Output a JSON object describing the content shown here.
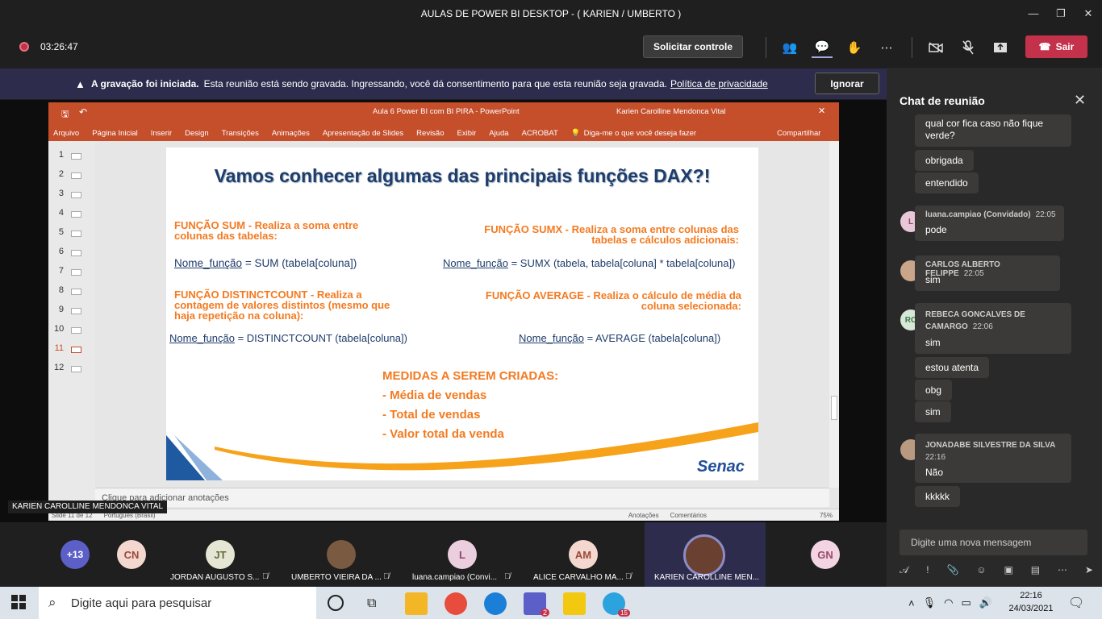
{
  "window": {
    "title": "AULAS DE POWER BI DESKTOP - ( KARIEN / UMBERTO )",
    "min": "—",
    "max": "❐",
    "close": "✕"
  },
  "toolbar": {
    "timer": "03:26:47",
    "request_control": "Solicitar controle",
    "leave_label": "Sair"
  },
  "banner": {
    "bold": "A gravação foi iniciada.",
    "text": "Esta reunião está sendo gravada. Ingressando, você dá consentimento para que esta reunião seja gravada.",
    "link": "Política de privacidade",
    "ignore": "Ignorar"
  },
  "ppt": {
    "doc_title": "Aula 6 Power BI com BI PIRA  -  PowerPoint",
    "user": "Karien Carolline Mendonca Vital",
    "ribbon": [
      "Arquivo",
      "Página Inicial",
      "Inserir",
      "Design",
      "Transições",
      "Animações",
      "Apresentação de Slides",
      "Revisão",
      "Exibir",
      "Ajuda",
      "ACROBAT"
    ],
    "tell_me": "Diga-me o que você deseja fazer",
    "share": "Compartilhar",
    "thumbs": [
      "1",
      "2",
      "3",
      "4",
      "5",
      "6",
      "7",
      "8",
      "9",
      "10",
      "11",
      "12"
    ],
    "notes": "Clique para adicionar anotações",
    "status_slide": "Slide 11 de 12",
    "status_lang": "Português (Brasil)",
    "status_notes": "Anotações",
    "status_comments": "Comentários",
    "zoom": "75%"
  },
  "slide": {
    "title": "Vamos conhecer algumas das principais funções DAX?!",
    "sum_head": "FUNÇÃO SUM - Realiza a soma entre colunas das tabelas:",
    "sum_formula_fn": "Nome_função",
    "sum_formula": " = SUM (tabela[coluna])",
    "sumx_head": "FUNÇÃO SUMX - Realiza a soma entre colunas das tabelas e cálculos adicionais:",
    "sumx_formula_fn": "Nome_função",
    "sumx_formula": " = SUMX (tabela, tabela[coluna] * tabela[coluna])",
    "dc_head": "FUNÇÃO DISTINCTCOUNT - Realiza a contagem de valores distintos (mesmo que haja repetição na coluna):",
    "dc_formula_fn": "Nome_função",
    "dc_formula": " = DISTINCTCOUNT (tabela[coluna])",
    "avg_head": "FUNÇÃO AVERAGE - Realiza o cálculo de média da coluna selecionada:",
    "avg_formula_fn": "Nome_função",
    "avg_formula": " = AVERAGE (tabela[coluna])",
    "medidas_head": "MEDIDAS A SEREM CRIADAS:",
    "medidas": [
      "-  Média de vendas",
      "-  Total de vendas",
      "-  Valor total da venda"
    ],
    "logo": "Senac"
  },
  "presenter_tag": "KARIEN CAROLLINE MENDONCA VITAL",
  "chat": {
    "title": "Chat de reunião",
    "messages": [
      {
        "text": "qual cor fica caso não fique verde?"
      },
      {
        "text": "obrigada"
      },
      {
        "text": "entendido"
      },
      {
        "author": "luana.campiao (Convidado)",
        "time": "22:05",
        "initials": "L",
        "text": "pode"
      },
      {
        "author": "CARLOS ALBERTO FELIPPE",
        "time": "22:05",
        "text": "sim"
      },
      {
        "author": "REBECA GONCALVES DE CAMARGO",
        "time": "22:06",
        "initials": "RC",
        "text": "sim"
      },
      {
        "text": "estou atenta"
      },
      {
        "text": "obg"
      },
      {
        "text": "sim"
      },
      {
        "author": "JONADABE SILVESTRE DA SILVA",
        "time": "22:16",
        "text": "Não"
      },
      {
        "text": "kkkkk"
      }
    ],
    "compose_placeholder": "Digite uma nova mensagem"
  },
  "participants": [
    {
      "initials": "+13"
    },
    {
      "initials": "CN"
    },
    {
      "initials": "JT",
      "name": "JORDAN AUGUSTO S..."
    },
    {
      "initials": "",
      "name": "UMBERTO VIEIRA DA ..."
    },
    {
      "initials": "L",
      "name": "luana.campiao (Convi..."
    },
    {
      "initials": "AM",
      "name": "ALICE CARVALHO MA..."
    },
    {
      "initials": "",
      "name": "KARIEN CAROLLINE MEN..."
    },
    {
      "initials": "GN"
    }
  ],
  "taskbar": {
    "search": "Digite aqui para pesquisar",
    "time": "22:16",
    "date": "24/03/2021",
    "teams_badge": "2",
    "telegram_badge": "15"
  },
  "colors": {
    "accent": "#6264a7",
    "leave": "#c4314b",
    "ppt": "#c54e2b",
    "orange": "#f47a20"
  }
}
